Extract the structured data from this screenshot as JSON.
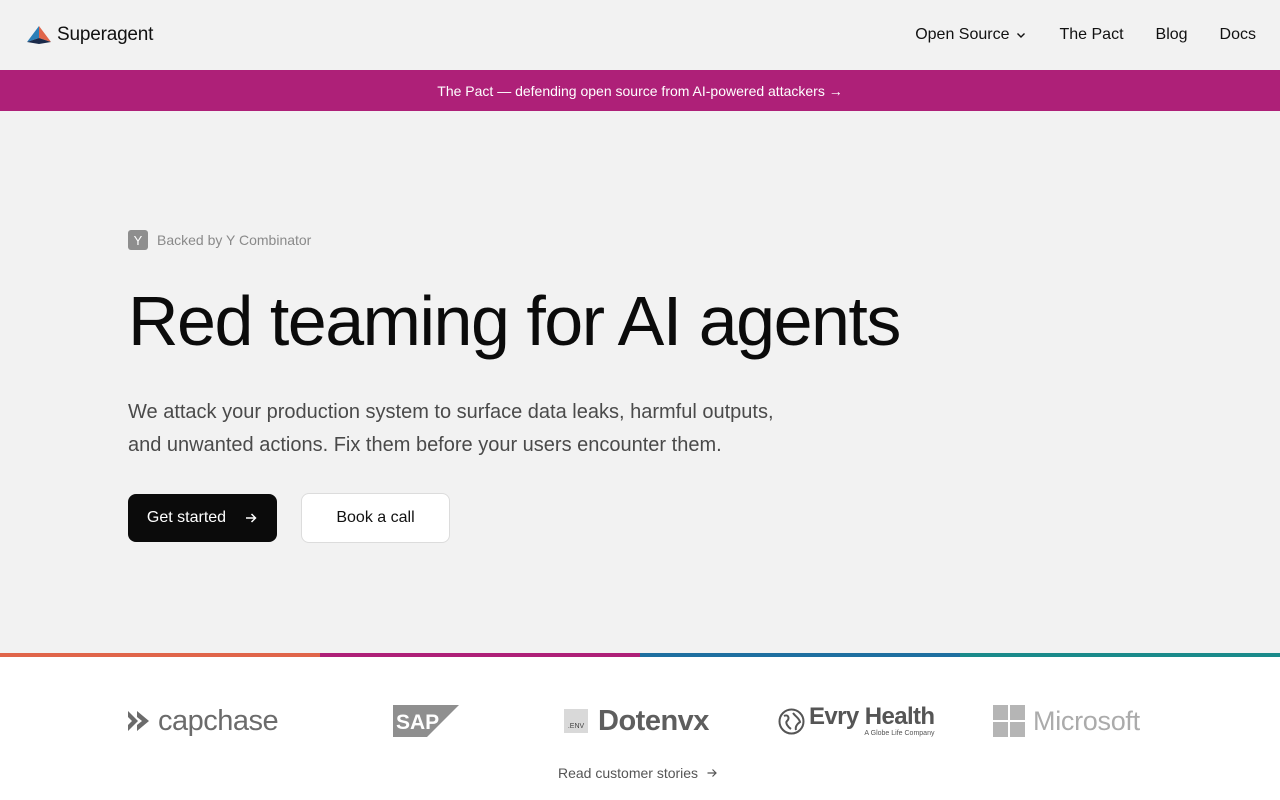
{
  "header": {
    "brand": "Superagent",
    "nav": [
      {
        "label": "Open Source",
        "has_dropdown": true
      },
      {
        "label": "The Pact"
      },
      {
        "label": "Blog"
      },
      {
        "label": "Docs"
      }
    ]
  },
  "banner": {
    "text": "The Pact — defending open source from AI-powered attackers →",
    "background": "#ae2078"
  },
  "hero": {
    "backer_badge": "Y",
    "backer_text": "Backed by Y Combinator",
    "headline": "Red teaming for AI agents",
    "subline_1": "We attack your production system to surface data leaks, harmful outputs,",
    "subline_2": "and unwanted actions. Fix them before your users encounter them.",
    "primary_cta": "Get started",
    "secondary_cta": "Book a call"
  },
  "color_rule": [
    "#e0654a",
    "#ae2078",
    "#1f6fa0",
    "#1a8a8a"
  ],
  "logos": {
    "capchase": "capchase",
    "sap": "SAP",
    "dotenvx_box": ".ENV",
    "dotenvx": "Dotenvx",
    "evry": "Evry Health",
    "evry_tag": "A Globe Life Company",
    "microsoft": "Microsoft"
  },
  "stories_link": "Read customer stories"
}
